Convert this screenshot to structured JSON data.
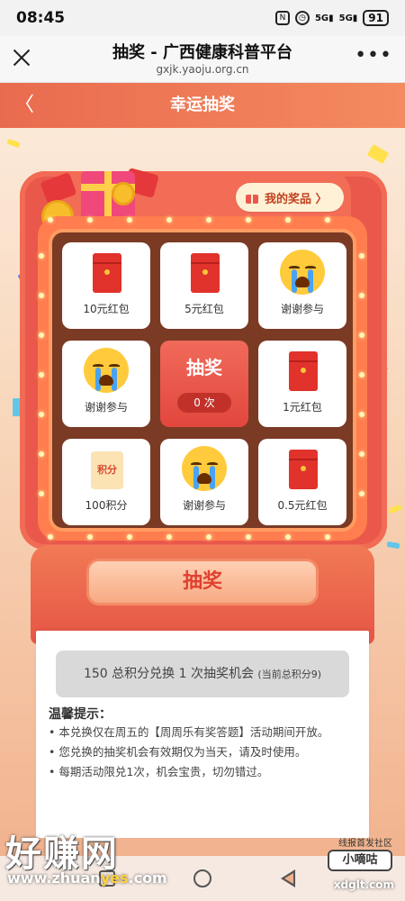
{
  "status_bar": {
    "time": "08:45",
    "icons": [
      "nfc-icon",
      "alarm-icon",
      "signal-5g-icon",
      "signal-5g-icon"
    ],
    "battery": "91"
  },
  "browser": {
    "title": "抽奖 - 广西健康科普平台",
    "url": "gxjk.yaoju.org.cn"
  },
  "header": {
    "title": "幸运抽奖"
  },
  "machine": {
    "my_prizes_label": "我的奖品 〉",
    "grid": [
      {
        "type": "red-envelope",
        "label": "10元红包"
      },
      {
        "type": "red-envelope",
        "label": "5元红包"
      },
      {
        "type": "cry-face",
        "label": "谢谢参与"
      },
      {
        "type": "cry-face",
        "label": "谢谢参与"
      },
      {
        "type": "draw-center",
        "label": "抽奖",
        "count": "0 次"
      },
      {
        "type": "red-envelope",
        "label": "1元红包"
      },
      {
        "type": "points",
        "label": "100积分",
        "icon_text": "积分"
      },
      {
        "type": "cry-face",
        "label": "谢谢参与"
      },
      {
        "type": "red-envelope",
        "label": "0.5元红包"
      }
    ],
    "draw_button": "抽奖"
  },
  "slip": {
    "exchange_main": "150 总积分兑换 1 次抽奖机会",
    "exchange_sub": "(当前总积分9)",
    "tips_title": "温馨提示：",
    "tips": [
      "本兑换仅在周五的【周周乐有奖答题】活动期间开放。",
      "您兑换的抽奖机会有效期仅为当天，请及时使用。",
      "每期活动限兑1次，机会宝贵，切勿错过。"
    ]
  },
  "watermark": {
    "left_big": "好赚网",
    "left_url_a": "www.zhuan",
    "left_url_b": "yes",
    "left_url_c": ".com",
    "right_top": "线报首发社区",
    "right_logo": "小嘀咕",
    "right_url": "xdglt.com"
  },
  "colors": {
    "header_start": "#e96b4f",
    "header_end": "#f48a5f",
    "machine": "#e9584b",
    "accent_red": "#e0402f"
  }
}
